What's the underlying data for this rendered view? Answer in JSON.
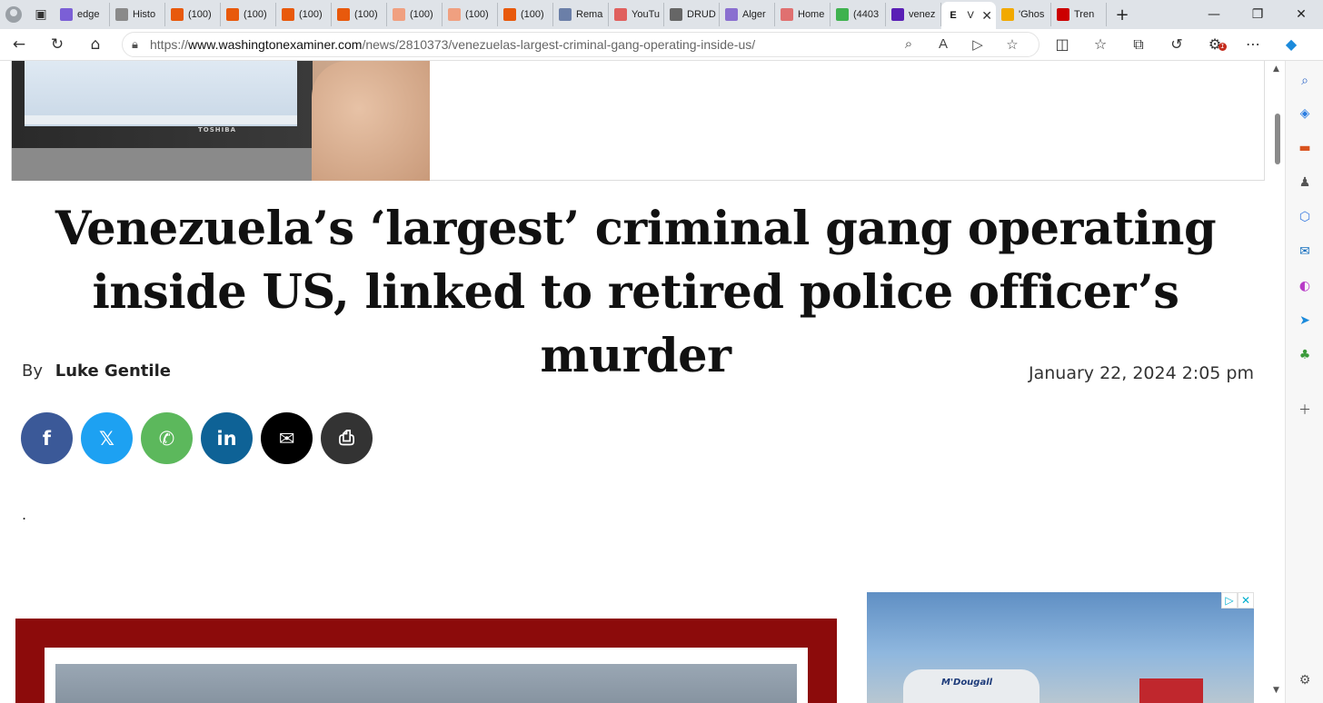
{
  "browser": {
    "tabs": [
      {
        "label": "edge",
        "icon": "yahoo-icon",
        "color": "#7b5fd6"
      },
      {
        "label": "Histo",
        "icon": "history-icon",
        "color": "#8a8a8a"
      },
      {
        "label": "(100)",
        "icon": "reader-icon",
        "color": "#e8590c"
      },
      {
        "label": "(100)",
        "icon": "reader-icon",
        "color": "#e8590c"
      },
      {
        "label": "(100)",
        "icon": "reader-icon",
        "color": "#e8590c"
      },
      {
        "label": "(100)",
        "icon": "reader-icon",
        "color": "#e8590c"
      },
      {
        "label": "(100)",
        "icon": "reader-icon",
        "color": "#f0a080"
      },
      {
        "label": "(100)",
        "icon": "reader-icon",
        "color": "#f0a080"
      },
      {
        "label": "(100)",
        "icon": "reader-icon",
        "color": "#e8590c"
      },
      {
        "label": "Rema",
        "icon": "remark-icon",
        "color": "#6b7fa8"
      },
      {
        "label": "YouTu",
        "icon": "youtube-icon",
        "color": "#e0605e"
      },
      {
        "label": "DRUD",
        "icon": "drudge-icon",
        "color": "#666666"
      },
      {
        "label": "Alger",
        "icon": "yahoo-icon",
        "color": "#8a6fd0"
      },
      {
        "label": "Home",
        "icon": "home-icon",
        "color": "#e07070"
      },
      {
        "label": "(4403",
        "icon": "g-icon",
        "color": "#3fb24f"
      },
      {
        "label": "venez",
        "icon": "yahoo-icon",
        "color": "#5a1fb5"
      }
    ],
    "active_tab": {
      "label": "V",
      "icon": "examiner-icon"
    },
    "tabs_after": [
      {
        "label": "'Ghos",
        "icon": "nbc-icon",
        "color": "#f2a900"
      },
      {
        "label": "Tren",
        "icon": "cnn-icon",
        "color": "#cc0000"
      }
    ],
    "url_prefix": "https://",
    "url_host": "www.washingtonexaminer.com",
    "url_path": "/news/2810373/venezuelas-largest-criminal-gang-operating-inside-us/",
    "notification_count": "1"
  },
  "article": {
    "headline": "Venezuela’s ‘largest’ criminal gang operating inside US, linked to retired police officer’s murder",
    "by_label": "By",
    "author": "Luke Gentile",
    "date": "January 22, 2024 2:05 pm",
    "body_placeholder": ".",
    "hero_brand": "TOSHIBA"
  },
  "share": [
    {
      "name": "facebook",
      "glyph": "f",
      "color": "#3b5998"
    },
    {
      "name": "x",
      "glyph": "𝕏",
      "color": "#1da1f2"
    },
    {
      "name": "whatsapp",
      "glyph": "✆",
      "color": "#5cb85c"
    },
    {
      "name": "linkedin",
      "glyph": "in",
      "color": "#0e6296"
    },
    {
      "name": "email",
      "glyph": "✉",
      "color": "#000000"
    },
    {
      "name": "print",
      "glyph": "⎙",
      "color": "#333333"
    }
  ],
  "ad": {
    "brand_text": "M'Dougall",
    "badges": [
      "▷",
      "✕"
    ]
  }
}
